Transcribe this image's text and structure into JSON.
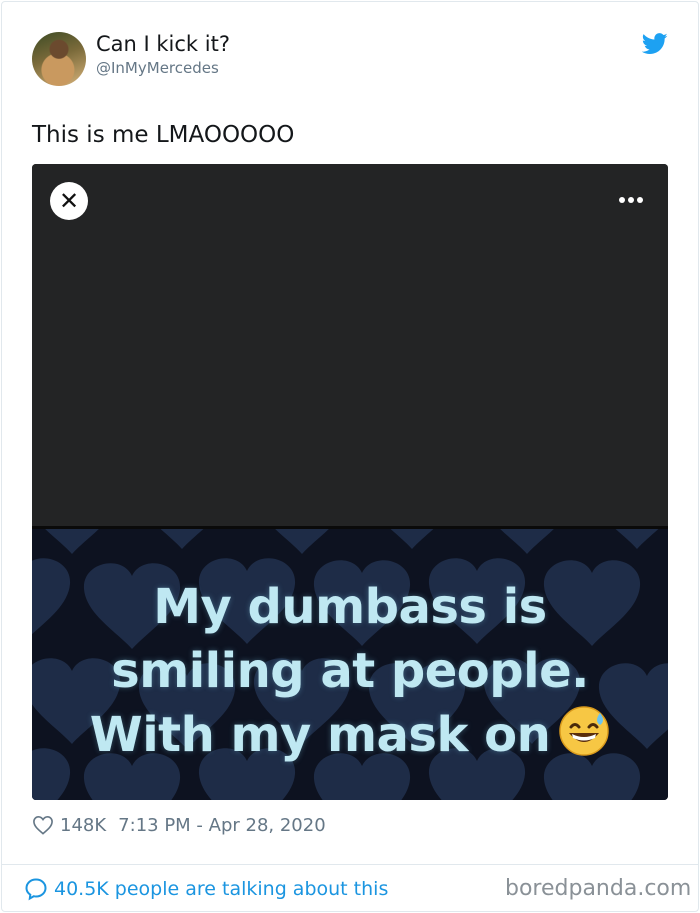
{
  "tweet": {
    "display_name": "Can I kick it?",
    "handle": "@InMyMercedes",
    "text": "This is me LMAOOOOO",
    "likes": "148K",
    "timestamp": "7:13 PM - Apr 28, 2020",
    "talking": "40.5K people are talking about this"
  },
  "media": {
    "meme_lines": [
      "My dumbass is",
      "smiling at people.",
      "With my mask on"
    ],
    "emoji": "grinning-face-with-sweat-emoji"
  },
  "icons": {
    "bird": "twitter-bird-icon",
    "close": "close-icon",
    "more": "more-dots-icon",
    "heart": "heart-icon",
    "bubble": "speech-bubble-icon"
  },
  "colors": {
    "twitter_blue": "#1da1f2",
    "link_blue": "#1b95e0",
    "meme_text": "#bfe8f2",
    "meme_bg": "#0d1220"
  },
  "watermark": "boredpanda.com"
}
